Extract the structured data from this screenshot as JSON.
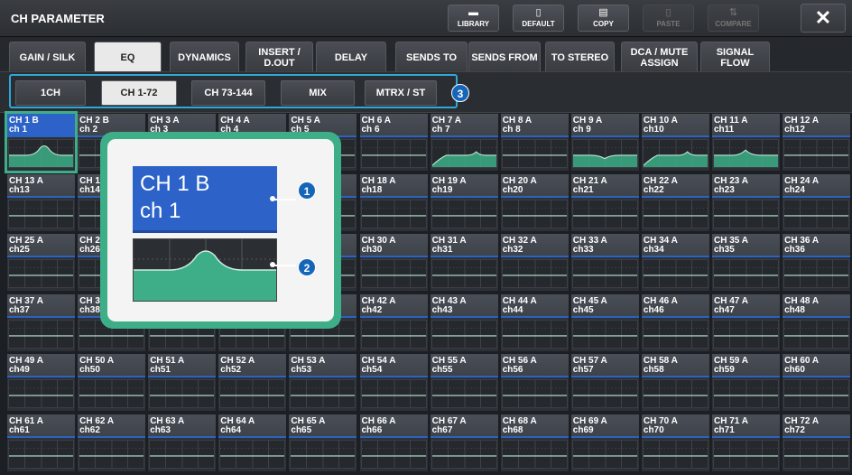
{
  "title": "CH PARAMETER",
  "toolbar": [
    {
      "label": "LIBRARY",
      "icon": "folder-icon",
      "glyph": "▬",
      "enabled": true
    },
    {
      "label": "DEFAULT",
      "icon": "document-icon",
      "glyph": "▯",
      "enabled": true
    },
    {
      "label": "COPY",
      "icon": "copy-icon",
      "glyph": "▤",
      "enabled": true
    },
    {
      "label": "PASTE",
      "icon": "paste-icon",
      "glyph": "▯",
      "enabled": false
    },
    {
      "label": "COMPARE",
      "icon": "compare-icon",
      "glyph": "⇅",
      "enabled": false
    }
  ],
  "close_glyph": "✕",
  "tabs": [
    "GAIN / SILK",
    "EQ",
    "DYNAMICS",
    "INSERT / D.OUT",
    "DELAY",
    "SENDS TO",
    "SENDS FROM",
    "TO STEREO",
    "DCA / MUTE ASSIGN",
    "SIGNAL FLOW"
  ],
  "active_tab": 1,
  "subtabs": [
    "1CH",
    "CH 1-72",
    "CH 73-144",
    "MIX",
    "MTRX / ST"
  ],
  "active_subtab": 1,
  "callouts": [
    "1",
    "2",
    "3"
  ],
  "zoom": {
    "name1": "CH 1 B",
    "name2": "ch 1"
  },
  "channels": [
    {
      "n1": "CH 1 B",
      "n2": "ch 1",
      "eq": "notch"
    },
    {
      "n1": "CH 2 B",
      "n2": "ch 2",
      "eq": "flat"
    },
    {
      "n1": "CH 3 A",
      "n2": "ch 3",
      "eq": "flat"
    },
    {
      "n1": "CH 4 A",
      "n2": "ch 4",
      "eq": "flat"
    },
    {
      "n1": "CH 5 A",
      "n2": "ch 5",
      "eq": "flat"
    },
    {
      "n1": "CH 6 A",
      "n2": "ch 6",
      "eq": "flat"
    },
    {
      "n1": "CH 7 A",
      "n2": "ch 7",
      "eq": "hpfpeak"
    },
    {
      "n1": "CH 8 A",
      "n2": "ch 8",
      "eq": "flat"
    },
    {
      "n1": "CH 9 A",
      "n2": "ch 9",
      "eq": "dip"
    },
    {
      "n1": "CH 10 A",
      "n2": "ch10",
      "eq": "hpfpeak"
    },
    {
      "n1": "CH 11 A",
      "n2": "ch11",
      "eq": "bump"
    },
    {
      "n1": "CH 12 A",
      "n2": "ch12",
      "eq": "flat"
    },
    {
      "n1": "CH 13 A",
      "n2": "ch13",
      "eq": "flat"
    },
    {
      "n1": "CH 14 A",
      "n2": "ch14",
      "eq": "flat"
    },
    {
      "n1": "CH 15 A",
      "n2": "ch15",
      "eq": "flat"
    },
    {
      "n1": "CH 16 A",
      "n2": "ch16",
      "eq": "flat"
    },
    {
      "n1": "CH 17 A",
      "n2": "ch17",
      "eq": "flat"
    },
    {
      "n1": "CH 18 A",
      "n2": "ch18",
      "eq": "flat"
    },
    {
      "n1": "CH 19 A",
      "n2": "ch19",
      "eq": "flat"
    },
    {
      "n1": "CH 20 A",
      "n2": "ch20",
      "eq": "flat"
    },
    {
      "n1": "CH 21 A",
      "n2": "ch21",
      "eq": "flat"
    },
    {
      "n1": "CH 22 A",
      "n2": "ch22",
      "eq": "flat"
    },
    {
      "n1": "CH 23 A",
      "n2": "ch23",
      "eq": "flat"
    },
    {
      "n1": "CH 24 A",
      "n2": "ch24",
      "eq": "flat"
    },
    {
      "n1": "CH 25 A",
      "n2": "ch25",
      "eq": "flat"
    },
    {
      "n1": "CH 26 A",
      "n2": "ch26",
      "eq": "flat"
    },
    {
      "n1": "CH 27 A",
      "n2": "ch27",
      "eq": "flat"
    },
    {
      "n1": "CH 28 A",
      "n2": "ch28",
      "eq": "flat"
    },
    {
      "n1": "CH 29 A",
      "n2": "ch29",
      "eq": "flat"
    },
    {
      "n1": "CH 30 A",
      "n2": "ch30",
      "eq": "flat"
    },
    {
      "n1": "CH 31 A",
      "n2": "ch31",
      "eq": "flat"
    },
    {
      "n1": "CH 32 A",
      "n2": "ch32",
      "eq": "flat"
    },
    {
      "n1": "CH 33 A",
      "n2": "ch33",
      "eq": "flat"
    },
    {
      "n1": "CH 34 A",
      "n2": "ch34",
      "eq": "flat"
    },
    {
      "n1": "CH 35 A",
      "n2": "ch35",
      "eq": "flat"
    },
    {
      "n1": "CH 36 A",
      "n2": "ch36",
      "eq": "flat"
    },
    {
      "n1": "CH 37 A",
      "n2": "ch37",
      "eq": "flat"
    },
    {
      "n1": "CH 38 A",
      "n2": "ch38",
      "eq": "flat"
    },
    {
      "n1": "CH 39 A",
      "n2": "ch39",
      "eq": "flat"
    },
    {
      "n1": "CH 40 A",
      "n2": "ch40",
      "eq": "flat"
    },
    {
      "n1": "CH 41 A",
      "n2": "ch41",
      "eq": "flat"
    },
    {
      "n1": "CH 42 A",
      "n2": "ch42",
      "eq": "flat"
    },
    {
      "n1": "CH 43 A",
      "n2": "ch43",
      "eq": "flat"
    },
    {
      "n1": "CH 44 A",
      "n2": "ch44",
      "eq": "flat"
    },
    {
      "n1": "CH 45 A",
      "n2": "ch45",
      "eq": "flat"
    },
    {
      "n1": "CH 46 A",
      "n2": "ch46",
      "eq": "flat"
    },
    {
      "n1": "CH 47 A",
      "n2": "ch47",
      "eq": "flat"
    },
    {
      "n1": "CH 48 A",
      "n2": "ch48",
      "eq": "flat"
    },
    {
      "n1": "CH 49 A",
      "n2": "ch49",
      "eq": "flat"
    },
    {
      "n1": "CH 50 A",
      "n2": "ch50",
      "eq": "flat"
    },
    {
      "n1": "CH 51 A",
      "n2": "ch51",
      "eq": "flat"
    },
    {
      "n1": "CH 52 A",
      "n2": "ch52",
      "eq": "flat"
    },
    {
      "n1": "CH 53 A",
      "n2": "ch53",
      "eq": "flat"
    },
    {
      "n1": "CH 54 A",
      "n2": "ch54",
      "eq": "flat"
    },
    {
      "n1": "CH 55 A",
      "n2": "ch55",
      "eq": "flat"
    },
    {
      "n1": "CH 56 A",
      "n2": "ch56",
      "eq": "flat"
    },
    {
      "n1": "CH 57 A",
      "n2": "ch57",
      "eq": "flat"
    },
    {
      "n1": "CH 58 A",
      "n2": "ch58",
      "eq": "flat"
    },
    {
      "n1": "CH 59 A",
      "n2": "ch59",
      "eq": "flat"
    },
    {
      "n1": "CH 60 A",
      "n2": "ch60",
      "eq": "flat"
    },
    {
      "n1": "CH 61 A",
      "n2": "ch61",
      "eq": "flat"
    },
    {
      "n1": "CH 62 A",
      "n2": "ch62",
      "eq": "flat"
    },
    {
      "n1": "CH 63 A",
      "n2": "ch63",
      "eq": "flat"
    },
    {
      "n1": "CH 64 A",
      "n2": "ch64",
      "eq": "flat"
    },
    {
      "n1": "CH 65 A",
      "n2": "ch65",
      "eq": "flat"
    },
    {
      "n1": "CH 66 A",
      "n2": "ch66",
      "eq": "flat"
    },
    {
      "n1": "CH 67 A",
      "n2": "ch67",
      "eq": "flat"
    },
    {
      "n1": "CH 68 A",
      "n2": "ch68",
      "eq": "flat"
    },
    {
      "n1": "CH 69 A",
      "n2": "ch69",
      "eq": "flat"
    },
    {
      "n1": "CH 70 A",
      "n2": "ch70",
      "eq": "flat"
    },
    {
      "n1": "CH 71 A",
      "n2": "ch71",
      "eq": "flat"
    },
    {
      "n1": "CH 72 A",
      "n2": "ch72",
      "eq": "flat"
    }
  ],
  "colors": {
    "accent": "#2d63c8",
    "eq_curve": "#3dae87",
    "callout": "#1566b8",
    "highlight": "#2fa7d8"
  }
}
